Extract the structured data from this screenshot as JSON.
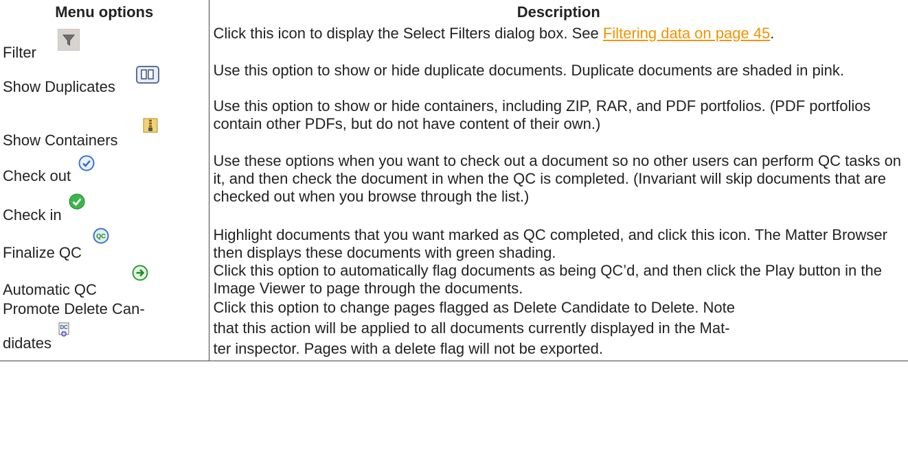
{
  "headers": {
    "menu_options": "Menu options",
    "description": "Description"
  },
  "rows": [
    {
      "option": "Filter",
      "icon": "filter-funnel-icon",
      "desc_before": "Click this icon to display the Select Filters dialog box. See ",
      "desc_link": "Filtering data on page 45",
      "desc_after": "."
    },
    {
      "option": "Show Duplicates",
      "icon": "duplicate-documents-icon",
      "desc": "Use this option to show or hide duplicate documents. Duplicate documents are shaded in pink."
    },
    {
      "option": "Show Containers",
      "icon": "zip-container-icon",
      "desc": "Use this option to show or hide containers, including ZIP, RAR, and PDF portfolios. (PDF portfolios contain other PDFs, but do not have content of their own.)"
    },
    {
      "option_1": "Check out",
      "icon_1": "check-out-blue-check-icon",
      "option_2": "Check in",
      "icon_2": "check-in-green-check-icon",
      "desc": "Use these options when you want to check out a document so no other users can perform QC tasks on it, and then check the document in when the QC is completed. (Invariant will skip documents that are checked out when you browse through the list.)"
    },
    {
      "option": "Finalize QC",
      "icon": "qc-badge-icon",
      "desc": "Highlight documents that you want marked as QC completed, and click this icon. The Matter Browser then displays these documents with green shading."
    },
    {
      "option": "Automatic QC",
      "icon": "green-arrow-icon",
      "desc": "Click this option to automatically flag documents as being QC’d, and then click the Play button in the Image Viewer to page through the documents."
    },
    {
      "option_line1": "Promote Delete Can-",
      "option_line2": "didates",
      "icon": "promote-delete-icon",
      "desc_line1": "Click this option to change pages flagged as Delete Candidate to Delete. Note",
      "desc_line2": "that this action will be applied to all documents currently displayed in the Mat-",
      "desc_line3": "ter inspector. Pages with a delete flag will not be exported."
    }
  ],
  "colors": {
    "link": "#f39200",
    "text": "#222222",
    "rule": "#444444"
  }
}
